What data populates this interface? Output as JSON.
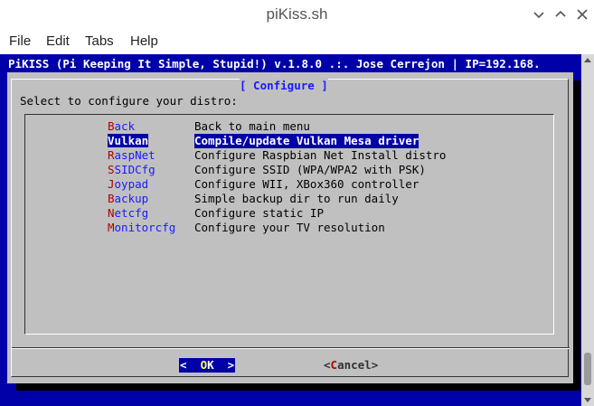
{
  "window": {
    "title": "piKiss.sh"
  },
  "menubar": {
    "items": [
      {
        "label": "File"
      },
      {
        "label": "Edit"
      },
      {
        "label": "Tabs"
      },
      {
        "label": "Help"
      }
    ]
  },
  "terminal": {
    "backtitle": "PiKISS (Pi Keeping It Simple, Stupid!) v.1.8.0 .:. Jose Cerrejon | IP=192.168.",
    "background_color": "#0000a8"
  },
  "dialog": {
    "title": "[ Configure ]",
    "prompt": "Select to configure your distro:",
    "items": [
      {
        "hotkey": "B",
        "rest": "ack",
        "description": "Back to main menu"
      },
      {
        "hotkey": "V",
        "rest": "ulkan",
        "description": "Compile/update Vulkan Mesa driver"
      },
      {
        "hotkey": "R",
        "rest": "aspNet",
        "description": "Configure Raspbian Net Install distro"
      },
      {
        "hotkey": "S",
        "rest": "SIDCfg",
        "description": "Configure SSID (WPA/WPA2 with PSK)"
      },
      {
        "hotkey": "J",
        "rest": "oypad",
        "description": "Configure WII, XBox360 controller"
      },
      {
        "hotkey": "B",
        "rest": "ackup",
        "description": "Simple backup dir to run daily"
      },
      {
        "hotkey": "N",
        "rest": "etcfg",
        "description": "Configure static IP"
      },
      {
        "hotkey": "M",
        "rest": "onitorcfg",
        "description": "Configure your TV resolution"
      }
    ],
    "selected_index": 1,
    "ok_button": {
      "left": "<  ",
      "hot": "O",
      "right": "K  >"
    },
    "cancel_button": {
      "left": "<",
      "hot": "C",
      "right": "ancel>"
    }
  }
}
